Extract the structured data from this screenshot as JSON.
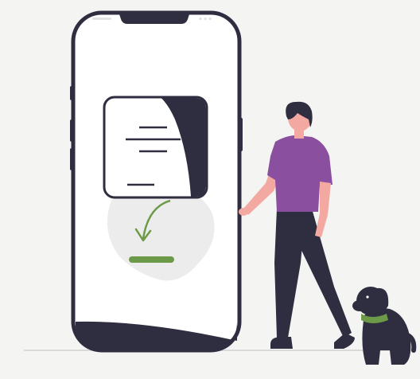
{
  "colors": {
    "background": "#f4f5f2",
    "phone_outline": "#2f2e41",
    "screen": "#ffffff",
    "accent_green": "#6c9a48",
    "shirt_purple": "#8b4fa0",
    "skin": "#f3a9a2",
    "dark": "#2f2e41",
    "blob_gray": "#ececec"
  },
  "icons": {
    "phone": "smartphone-icon",
    "document": "document-icon",
    "download_arrow": "download-arrow-icon",
    "person": "person-figure",
    "dog": "dog-figure"
  }
}
